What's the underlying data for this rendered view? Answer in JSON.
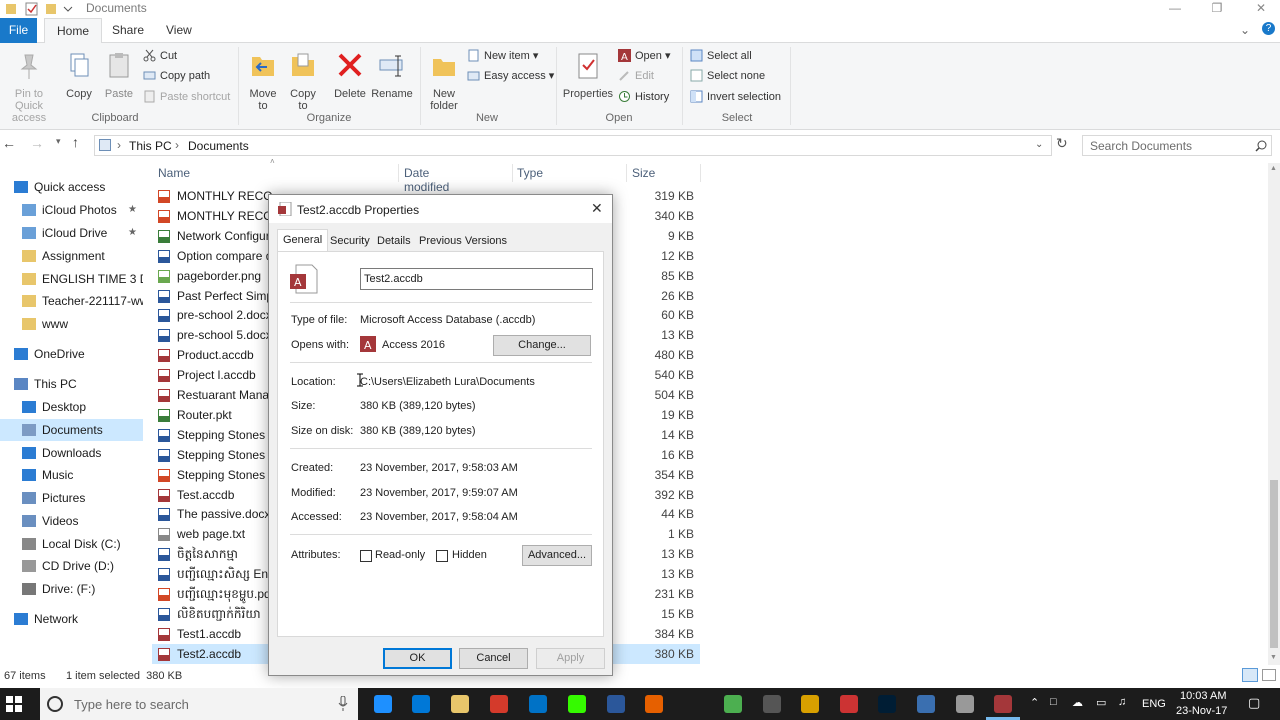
{
  "window": {
    "title": "Documents"
  },
  "ribbon_tabs": [
    "File",
    "Home",
    "Share",
    "View"
  ],
  "ribbon": {
    "clipboard": {
      "label": "Clipboard",
      "pin_label_1": "Pin to Quick",
      "pin_label_2": "access",
      "copy": "Copy",
      "paste": "Paste",
      "cut": "Cut",
      "copy_path": "Copy path",
      "paste_shortcut": "Paste shortcut"
    },
    "organize": {
      "label": "Organize",
      "move_to_1": "Move",
      "move_to_2": "to",
      "copy_to_1": "Copy",
      "copy_to_2": "to",
      "delete": "Delete",
      "rename": "Rename"
    },
    "new": {
      "label": "New",
      "new_folder_1": "New",
      "new_folder_2": "folder",
      "new_item": "New item",
      "easy_access": "Easy access"
    },
    "open": {
      "label": "Open",
      "properties": "Properties",
      "open": "Open",
      "edit": "Edit",
      "history": "History"
    },
    "select": {
      "label": "Select",
      "select_all": "Select all",
      "select_none": "Select none",
      "invert": "Invert selection"
    }
  },
  "address": {
    "this_pc": "This PC",
    "documents": "Documents",
    "search_placeholder": "Search Documents"
  },
  "nav": [
    {
      "label": "Quick access",
      "icon": "star-icon",
      "pinned": false,
      "indent": 0
    },
    {
      "label": "iCloud Photos",
      "icon": "icloud-icon",
      "pinned": true,
      "indent": 1
    },
    {
      "label": "iCloud Drive",
      "icon": "icloud-icon",
      "pinned": true,
      "indent": 1
    },
    {
      "label": "Assignment",
      "icon": "folder-icon",
      "pinned": false,
      "indent": 1
    },
    {
      "label": "ENGLISH TIME 3 DI:",
      "icon": "folder-icon",
      "pinned": false,
      "indent": 1
    },
    {
      "label": "Teacher-221117-ww",
      "icon": "folder-icon",
      "pinned": false,
      "indent": 1
    },
    {
      "label": "www",
      "icon": "folder-icon",
      "pinned": false,
      "indent": 1
    },
    {
      "label": "OneDrive",
      "icon": "onedrive-icon",
      "pinned": false,
      "indent": 0
    },
    {
      "label": "This PC",
      "icon": "pc-icon",
      "pinned": false,
      "indent": 0
    },
    {
      "label": "Desktop",
      "icon": "desktop-icon",
      "pinned": false,
      "indent": 1
    },
    {
      "label": "Documents",
      "icon": "documents-icon",
      "pinned": false,
      "indent": 1,
      "selected": true
    },
    {
      "label": "Downloads",
      "icon": "downloads-icon",
      "pinned": false,
      "indent": 1
    },
    {
      "label": "Music",
      "icon": "music-icon",
      "pinned": false,
      "indent": 1
    },
    {
      "label": "Pictures",
      "icon": "pictures-icon",
      "pinned": false,
      "indent": 1
    },
    {
      "label": "Videos",
      "icon": "videos-icon",
      "pinned": false,
      "indent": 1
    },
    {
      "label": "Local Disk (C:)",
      "icon": "disk-icon",
      "pinned": false,
      "indent": 1
    },
    {
      "label": "CD Drive (D:)",
      "icon": "cd-icon",
      "pinned": false,
      "indent": 1
    },
    {
      "label": "Drive: (F:)",
      "icon": "drive-icon",
      "pinned": false,
      "indent": 1
    },
    {
      "label": "Network",
      "icon": "network-icon",
      "pinned": false,
      "indent": 0
    }
  ],
  "columns": {
    "name": "Name",
    "date": "Date modified",
    "type": "Type",
    "size": "Size"
  },
  "files": [
    {
      "name": "MONTHLY RECORD",
      "size": "319 KB",
      "icon": "pdf-icon"
    },
    {
      "name": "MONTHLY RECORD",
      "size": "340 KB",
      "icon": "pdf-icon"
    },
    {
      "name": "Network Configur",
      "size": "9 KB",
      "icon": "pkt-icon"
    },
    {
      "name": "Option compare d",
      "size": "12 KB",
      "icon": "word-icon"
    },
    {
      "name": "pageborder.png",
      "size": "85 KB",
      "icon": "image-icon"
    },
    {
      "name": "Past Perfect Simpl",
      "size": "26 KB",
      "icon": "word-icon"
    },
    {
      "name": "pre-school 2.docx",
      "size": "60 KB",
      "icon": "word-icon"
    },
    {
      "name": "pre-school 5.docx",
      "size": "13 KB",
      "icon": "word-icon"
    },
    {
      "name": "Product.accdb",
      "size": "480 KB",
      "icon": "access-icon"
    },
    {
      "name": "Project l.accdb",
      "size": "540 KB",
      "icon": "access-icon"
    },
    {
      "name": "Restuarant Manag",
      "size": "504 KB",
      "icon": "access-icon"
    },
    {
      "name": "Router.pkt",
      "size": "19 KB",
      "icon": "pkt-icon"
    },
    {
      "name": "Stepping Stones C",
      "size": "14 KB",
      "icon": "word-icon"
    },
    {
      "name": "Stepping Stones in",
      "size": "16 KB",
      "icon": "word-icon"
    },
    {
      "name": "Stepping Stones in",
      "size": "354 KB",
      "icon": "pdf-icon"
    },
    {
      "name": "Test.accdb",
      "size": "392 KB",
      "icon": "access-icon"
    },
    {
      "name": "The passive.docx",
      "size": "44 KB",
      "icon": "word-icon"
    },
    {
      "name": "web page.txt",
      "size": "1 KB",
      "icon": "text-icon"
    },
    {
      "name": "ចិត្តនៃសាកម្មា",
      "size": "13 KB",
      "icon": "word-icon"
    },
    {
      "name": "បញ្ជីឈ្មោះសិស្ស Engl",
      "size": "13 KB",
      "icon": "word-icon"
    },
    {
      "name": "បញ្ជីឈ្មោះមុខម្ហូប.pd",
      "size": "231 KB",
      "icon": "pdf-icon"
    },
    {
      "name": "លិខិតបញ្ជាក់កិរិយា",
      "size": "15 KB",
      "icon": "word-icon"
    },
    {
      "name": "Test1.accdb",
      "size": "384 KB",
      "icon": "access-icon"
    },
    {
      "name": "Test2.accdb",
      "size": "380 KB",
      "icon": "access-icon",
      "selected": true
    }
  ],
  "status": {
    "count": "67 items",
    "selected": "1 item selected  380 KB"
  },
  "dialog": {
    "title": "Test2.accdb Properties",
    "tabs": [
      "General",
      "Security",
      "Details",
      "Previous Versions"
    ],
    "filename": "Test2.accdb",
    "type_label": "Type of file:",
    "type_value": "Microsoft Access Database (.accdb)",
    "opens_label": "Opens with:",
    "opens_value": "Access 2016",
    "change": "Change...",
    "location_label": "Location:",
    "location_value": "C:\\Users\\Elizabeth Lura\\Documents",
    "size_label": "Size:",
    "size_value": "380 KB (389,120 bytes)",
    "disk_label": "Size on disk:",
    "disk_value": "380 KB (389,120 bytes)",
    "created_label": "Created:",
    "created_value": "23 November, 2017, 9:58:03 AM",
    "modified_label": "Modified:",
    "modified_value": "23 November, 2017, 9:59:07 AM",
    "accessed_label": "Accessed:",
    "accessed_value": "23 November, 2017, 9:58:04 AM",
    "attributes_label": "Attributes:",
    "readonly": "Read-only",
    "hidden": "Hidden",
    "advanced": "Advanced...",
    "ok": "OK",
    "cancel": "Cancel",
    "apply": "Apply"
  },
  "taskbar": {
    "search_placeholder": "Type here to search",
    "lang": "ENG",
    "time": "10:03 AM",
    "date": "23-Nov-17"
  },
  "colors": {
    "accent": "#1979ca",
    "selection": "#cce8ff",
    "access": "#a4373a",
    "word": "#2b579a"
  }
}
